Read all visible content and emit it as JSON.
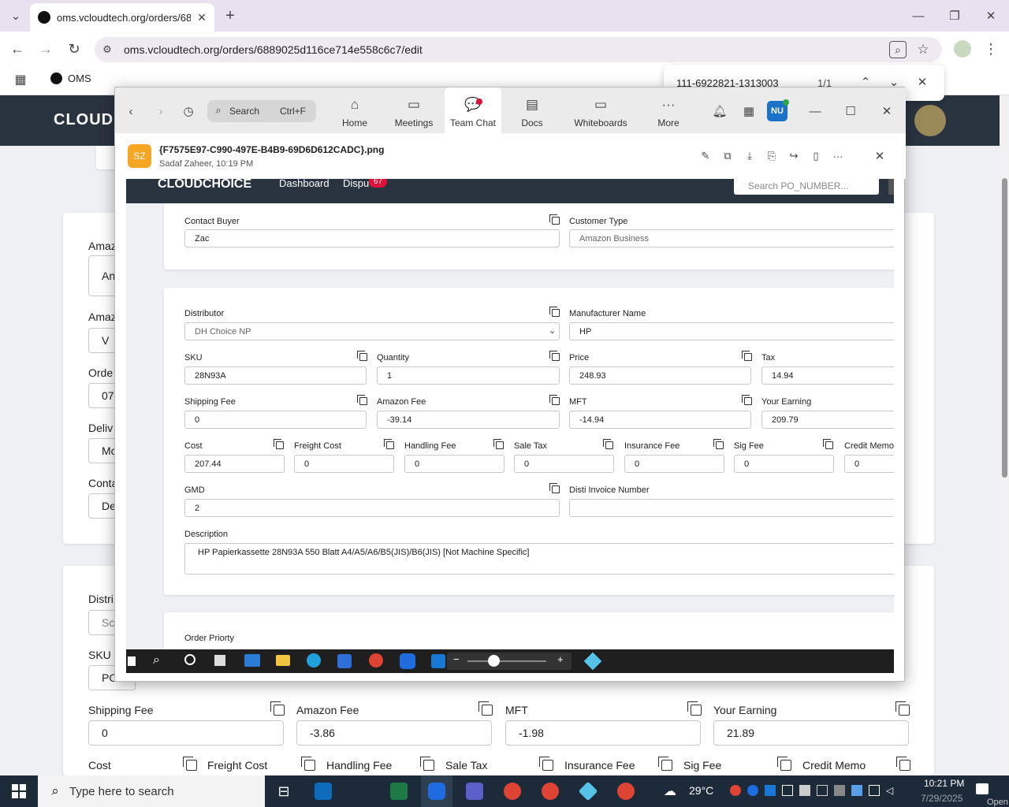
{
  "browser": {
    "tab_title": "oms.vcloudtech.org/orders/688",
    "url": "oms.vcloudtech.org/orders/6889025d116ce714e558c6c7/edit",
    "bookmark_label": "OMS",
    "find_query": "111-6922821-1313003",
    "find_count": "1/1"
  },
  "page": {
    "brand": "CLOUD",
    "labels": {
      "amazon1": "Amaz",
      "amazon2": "Amaz",
      "order": "Orde",
      "delivery": "Deliv",
      "contact": "Conta",
      "distributor": "Distri",
      "sku": "SKU",
      "shipping_fee": "Shipping Fee",
      "amazon_fee": "Amazon Fee",
      "mft": "MFT",
      "your_earning": "Your Earning",
      "cost": "Cost",
      "freight_cost": "Freight Cost",
      "handling_fee": "Handling Fee",
      "sale_tax": "Sale Tax",
      "insurance_fee": "Insurance Fee",
      "sig_fee": "Sig Fee",
      "credit_memo": "Credit Memo"
    },
    "values": {
      "amazon1": "An",
      "amazon2": "V",
      "order": "07",
      "delivery": "Mc",
      "contact": "De",
      "distributor": "Sc",
      "sku": "PO",
      "shipping_fee": "0",
      "amazon_fee": "-3.86",
      "mft": "-1.98",
      "your_earning": "21.89"
    }
  },
  "teams": {
    "nav": {
      "search": "Search",
      "shortcut": "Ctrl+F",
      "home": "Home",
      "meetings": "Meetings",
      "team_chat": "Team Chat",
      "docs": "Docs",
      "whiteboards": "Whiteboards",
      "more": "More",
      "avatar": "NU"
    },
    "viewer": {
      "avatar": "SZ",
      "filename": "{F7575E97-C990-497E-B4B9-69D6D612CADC}.png",
      "sender": "Sadaf Zaheer, 10:19 PM"
    }
  },
  "shot": {
    "brand": "CLOUDCHOICE",
    "nav_dashboard": "Dashboard",
    "nav_dispu": "Dispu",
    "badge": "67",
    "search_placeholder": "Search PO_NUMBER...",
    "labels": {
      "contact_buyer": "Contact Buyer",
      "customer_type": "Customer Type",
      "distributor": "Distributor",
      "manufacturer": "Manufacturer Name",
      "sku": "SKU",
      "quantity": "Quantity",
      "price": "Price",
      "tax": "Tax",
      "shipping_fee": "Shipping Fee",
      "amazon_fee": "Amazon Fee",
      "mft": "MFT",
      "your_earning": "Your Earning",
      "cost": "Cost",
      "freight_cost": "Freight Cost",
      "handling_fee": "Handling Fee",
      "sale_tax": "Sale Tax",
      "insurance_fee": "Insurance Fee",
      "sig_fee": "Sig Fee",
      "credit_memo": "Credit Memo",
      "gmd": "GMD",
      "disti_invoice": "Disti Invoice Number",
      "description": "Description",
      "order_priority": "Order Priorty"
    },
    "values": {
      "contact_buyer": "Zac",
      "customer_type": "Amazon Business",
      "distributor": "DH Choice NP",
      "manufacturer": "HP",
      "sku": "28N93A",
      "quantity": "1",
      "price": "248.93",
      "tax": "14.94",
      "shipping_fee": "0",
      "amazon_fee": "-39.14",
      "mft": "-14.94",
      "your_earning": "209.79",
      "cost": "207.44",
      "freight_cost": "0",
      "handling_fee": "0",
      "sale_tax": "0",
      "insurance_fee": "0",
      "sig_fee": "0",
      "credit_memo": "0",
      "gmd": "2",
      "disti_invoice": "",
      "description": "HP Papierkassette 28N93A 550 Blatt A4/A5/A6/B5(JIS)/B6(JIS) [Not Machine Specific]"
    }
  },
  "taskbar": {
    "search_placeholder": "Type here to search",
    "weather": "29°C",
    "time": "10:21 PM",
    "date": "7/29/2025",
    "open": "Open"
  }
}
